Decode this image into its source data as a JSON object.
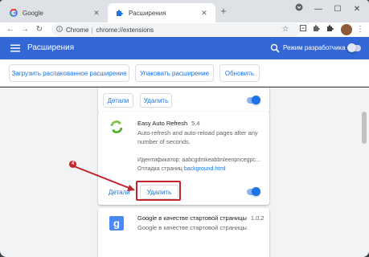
{
  "browser": {
    "tabs": [
      {
        "label": "Google",
        "active": false
      },
      {
        "label": "Расширения",
        "active": true
      }
    ],
    "toolbar": {
      "chip_label": "Chrome",
      "separator": "|",
      "url": "chrome://extensions"
    }
  },
  "extensions_page": {
    "title": "Расширения",
    "dev_mode_label": "Режим разработчика",
    "dev_mode_on": false,
    "dev_buttons": [
      "Загрузить распакованное расширение",
      "Упаковать расширение",
      "Обновить"
    ],
    "cards": [
      {
        "details_label": "Детали",
        "remove_label": "Удалить",
        "enabled": true
      },
      {
        "name": "Easy Auto Refresh",
        "version": "5.4",
        "description": "Auto-refresh and auto-reload pages after any number of seconds.",
        "id_label": "Идентификатор: aabcgdmkeabbnleenpncegpc...",
        "inspect_label": "Отладка страниц",
        "inspect_link": "background.html",
        "details_label": "Детали",
        "remove_label": "Удалить",
        "enabled": true,
        "icon": "refresh-icon"
      },
      {
        "name": "Google в качестве стартовой страницы",
        "version": "1.0.2",
        "description": "Google в качестве стартовой страницы",
        "icon": "google-icon"
      }
    ]
  },
  "annotation": {
    "step": "4",
    "color": "#c0262c"
  },
  "colors": {
    "header": "#3367d6",
    "link": "#1a73e8",
    "background": "#f1f3f4"
  }
}
